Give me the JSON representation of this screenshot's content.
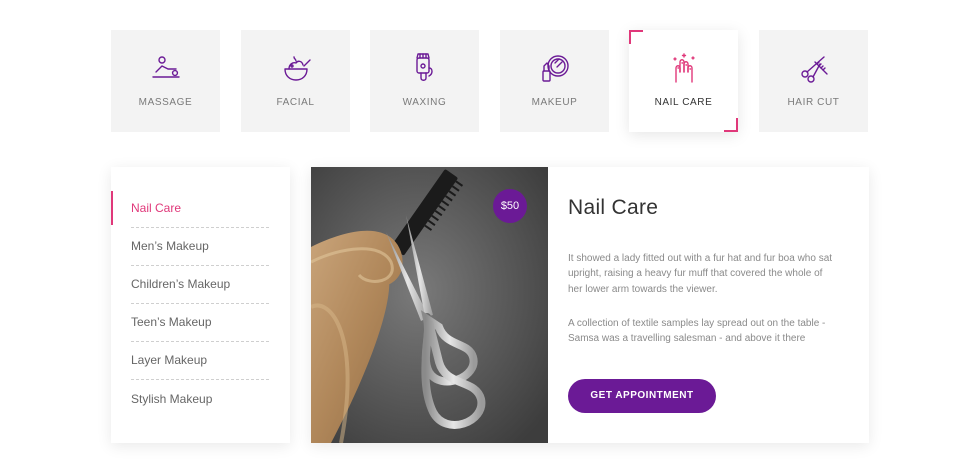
{
  "services": {
    "tabs": [
      {
        "label": "MASSAGE",
        "icon": "massage-icon"
      },
      {
        "label": "FACIAL",
        "icon": "facial-bowl-icon"
      },
      {
        "label": "WAXING",
        "icon": "waxing-icon"
      },
      {
        "label": "MAKEUP",
        "icon": "makeup-mirror-icon"
      },
      {
        "label": "NAIL CARE",
        "icon": "nail-care-hand-icon",
        "active": true
      },
      {
        "label": "HAIR CUT",
        "icon": "scissors-comb-icon"
      }
    ]
  },
  "sidebar": {
    "items": [
      {
        "label": "Nail Care",
        "active": true
      },
      {
        "label": "Men’s Makeup"
      },
      {
        "label": "Children’s Makeup"
      },
      {
        "label": "Teen’s Makeup"
      },
      {
        "label": "Layer Makeup"
      },
      {
        "label": "Stylish Makeup"
      }
    ]
  },
  "detail": {
    "price": "$50",
    "title": "Nail Care",
    "paragraph1": "It showed a lady fitted out with a fur hat and fur boa who sat upright, raising a heavy fur muff that covered the whole of her lower arm towards the viewer.",
    "paragraph2": "A collection of textile samples lay spread out on the table - Samsa was a travelling salesman - and above it there",
    "button_label": "GET APPOINTMENT",
    "image": "scissors-comb-hair-photo"
  },
  "colors": {
    "accent_pink": "#e0387a",
    "brand_purple": "#6b1a96",
    "icon_purple": "#6b1a96"
  }
}
